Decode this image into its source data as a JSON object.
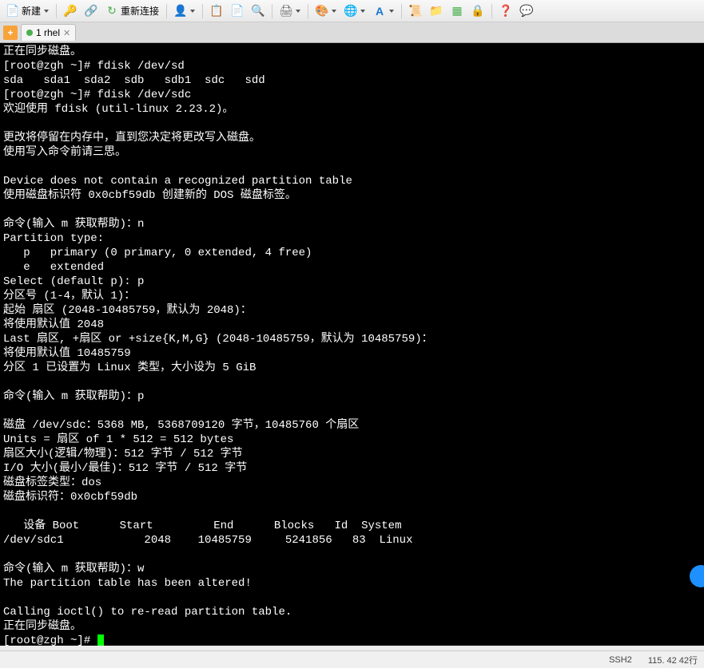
{
  "toolbar": {
    "new_label": "新建",
    "reconnect_label": "重新连接"
  },
  "tabs": {
    "items": [
      {
        "label": "1 rhel"
      }
    ]
  },
  "terminal_lines": [
    "正在同步磁盘。",
    "[root@zgh ~]# fdisk /dev/sd",
    "sda   sda1  sda2  sdb   sdb1  sdc   sdd",
    "[root@zgh ~]# fdisk /dev/sdc",
    "欢迎使用 fdisk (util-linux 2.23.2)。",
    "",
    "更改将停留在内存中，直到您决定将更改写入磁盘。",
    "使用写入命令前请三思。",
    "",
    "Device does not contain a recognized partition table",
    "使用磁盘标识符 0x0cbf59db 创建新的 DOS 磁盘标签。",
    "",
    "命令(输入 m 获取帮助)：n",
    "Partition type:",
    "   p   primary (0 primary, 0 extended, 4 free)",
    "   e   extended",
    "Select (default p): p",
    "分区号 (1-4，默认 1)：",
    "起始 扇区 (2048-10485759，默认为 2048)：",
    "将使用默认值 2048",
    "Last 扇区, +扇区 or +size{K,M,G} (2048-10485759，默认为 10485759)：",
    "将使用默认值 10485759",
    "分区 1 已设置为 Linux 类型，大小设为 5 GiB",
    "",
    "命令(输入 m 获取帮助)：p",
    "",
    "磁盘 /dev/sdc：5368 MB, 5368709120 字节，10485760 个扇区",
    "Units = 扇区 of 1 * 512 = 512 bytes",
    "扇区大小(逻辑/物理)：512 字节 / 512 字节",
    "I/O 大小(最小/最佳)：512 字节 / 512 字节",
    "磁盘标签类型：dos",
    "磁盘标识符：0x0cbf59db",
    "",
    "   设备 Boot      Start         End      Blocks   Id  System",
    "/dev/sdc1            2048    10485759     5241856   83  Linux",
    "",
    "命令(输入 m 获取帮助)：w",
    "The partition table has been altered!",
    "",
    "Calling ioctl() to re-read partition table.",
    "正在同步磁盘。",
    "[root@zgh ~]# "
  ],
  "status": {
    "ssh": "SSH2",
    "pos": "115. 42  42行"
  }
}
